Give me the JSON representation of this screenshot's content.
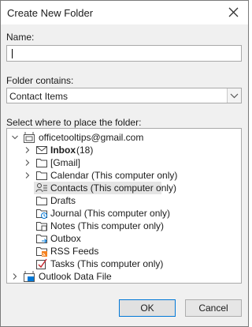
{
  "dialog": {
    "title": "Create New Folder"
  },
  "name_field": {
    "label": "Name:",
    "value": ""
  },
  "folder_contains": {
    "label": "Folder contains:",
    "selected": "Contact Items"
  },
  "placement": {
    "label": "Select where to place the folder:",
    "tree": [
      {
        "label": "officetooltips@gmail.com",
        "icon": "mailbox-icon",
        "expanded": true
      },
      {
        "label": "Inbox",
        "count": "(18)",
        "icon": "inbox-icon",
        "bold": true
      },
      {
        "label": "[Gmail]",
        "icon": "folder-icon"
      },
      {
        "label": "Calendar (This computer only)",
        "icon": "folder-icon"
      },
      {
        "label": "Contacts (This computer only)",
        "icon": "contacts-icon",
        "selected": true
      },
      {
        "label": "Drafts",
        "icon": "folder-icon"
      },
      {
        "label": "Journal (This computer only)",
        "icon": "journal-icon"
      },
      {
        "label": "Notes (This computer only)",
        "icon": "notes-icon"
      },
      {
        "label": "Outbox",
        "icon": "outbox-icon"
      },
      {
        "label": "RSS Feeds",
        "icon": "rss-icon"
      },
      {
        "label": "Tasks (This computer only)",
        "icon": "tasks-icon"
      },
      {
        "label": "Outlook Data File",
        "icon": "data-file-icon"
      }
    ]
  },
  "buttons": {
    "ok": "OK",
    "cancel": "Cancel"
  },
  "colors": {
    "accent": "#0078d7",
    "count": "#0b5fb8",
    "rss": "#f58220",
    "tasks": "#c4262e"
  }
}
